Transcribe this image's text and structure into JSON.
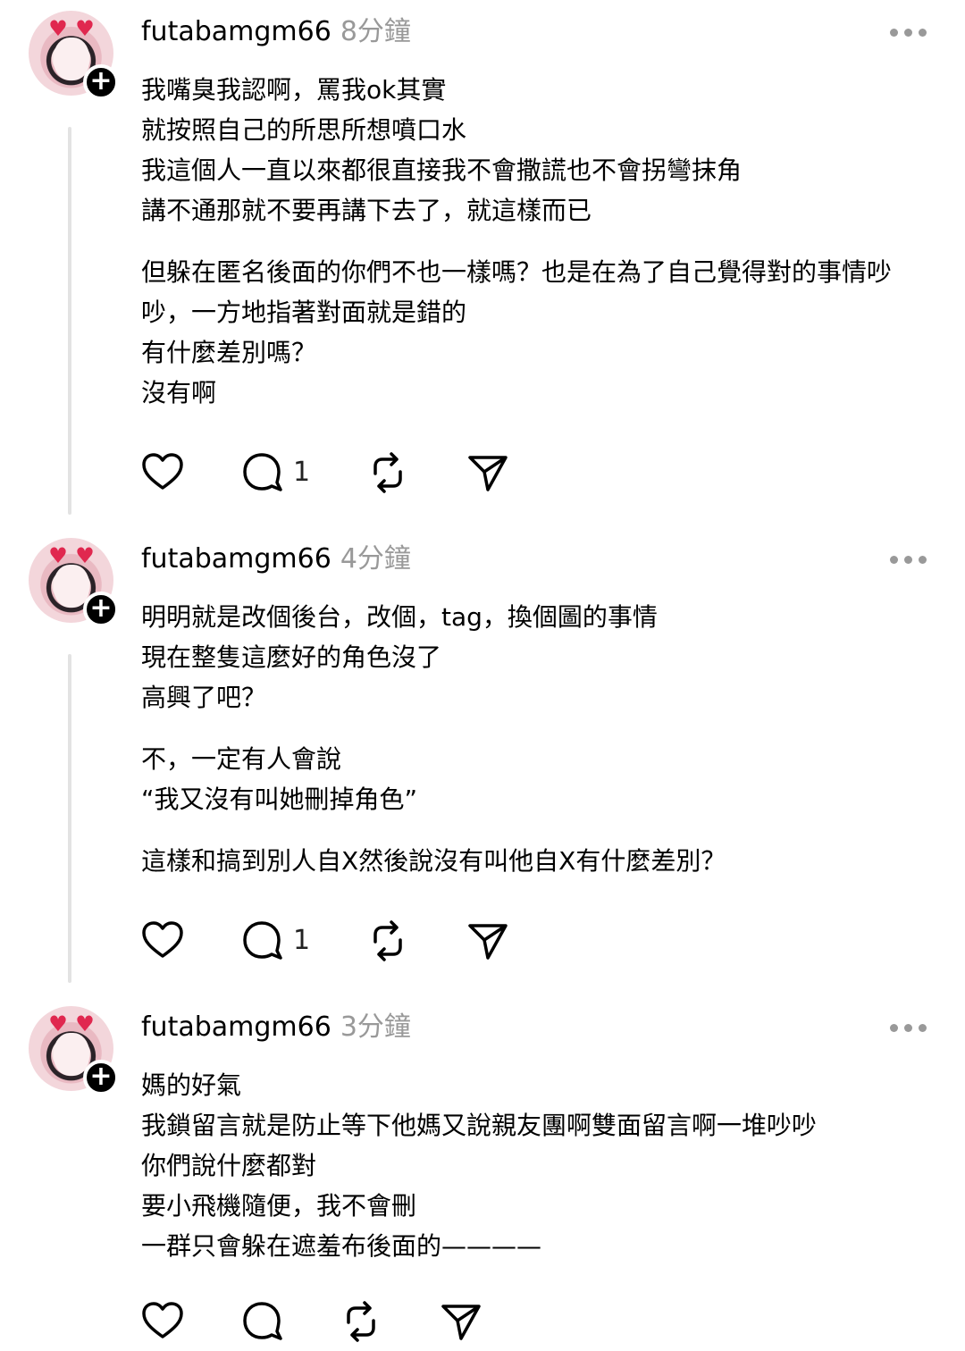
{
  "posts": [
    {
      "username": "futabamgm66",
      "time": "8分鐘",
      "paragraphs": [
        [
          "我嘴臭我認啊，罵我ok其實",
          "就按照自己的所思所想噴口水",
          "我這個人一直以來都很直接我不會撒謊也不會拐彎抹角",
          "講不通那就不要再講下去了，就這樣而已"
        ],
        [
          "但躲在匿名後面的你們不也一樣嗎？也是在為了自己覺得對的事情吵",
          "吵，一方地指著對面就是錯的",
          "有什麼差別嗎？",
          "沒有啊"
        ]
      ],
      "reply_count": "1"
    },
    {
      "username": "futabamgm66",
      "time": "4分鐘",
      "paragraphs": [
        [
          "明明就是改個後台，改個，tag，換個圖的事情",
          "現在整隻這麼好的角色沒了",
          "高興了吧？"
        ],
        [
          "不，一定有人會說",
          "“我又沒有叫她刪掉角色”"
        ],
        [
          "這樣和搞到別人自X然後說沒有叫他自X有什麼差別？"
        ]
      ],
      "reply_count": "1"
    },
    {
      "username": "futabamgm66",
      "time": "3分鐘",
      "paragraphs": [
        [
          "媽的好氣",
          "我鎖留言就是防止等下他媽又說親友團啊雙面留言啊一堆吵吵",
          "你們說什麼都對",
          "要小飛機隨便，我不會刪",
          "一群只會躲在遮羞布後面的————"
        ]
      ],
      "reply_count": ""
    }
  ]
}
